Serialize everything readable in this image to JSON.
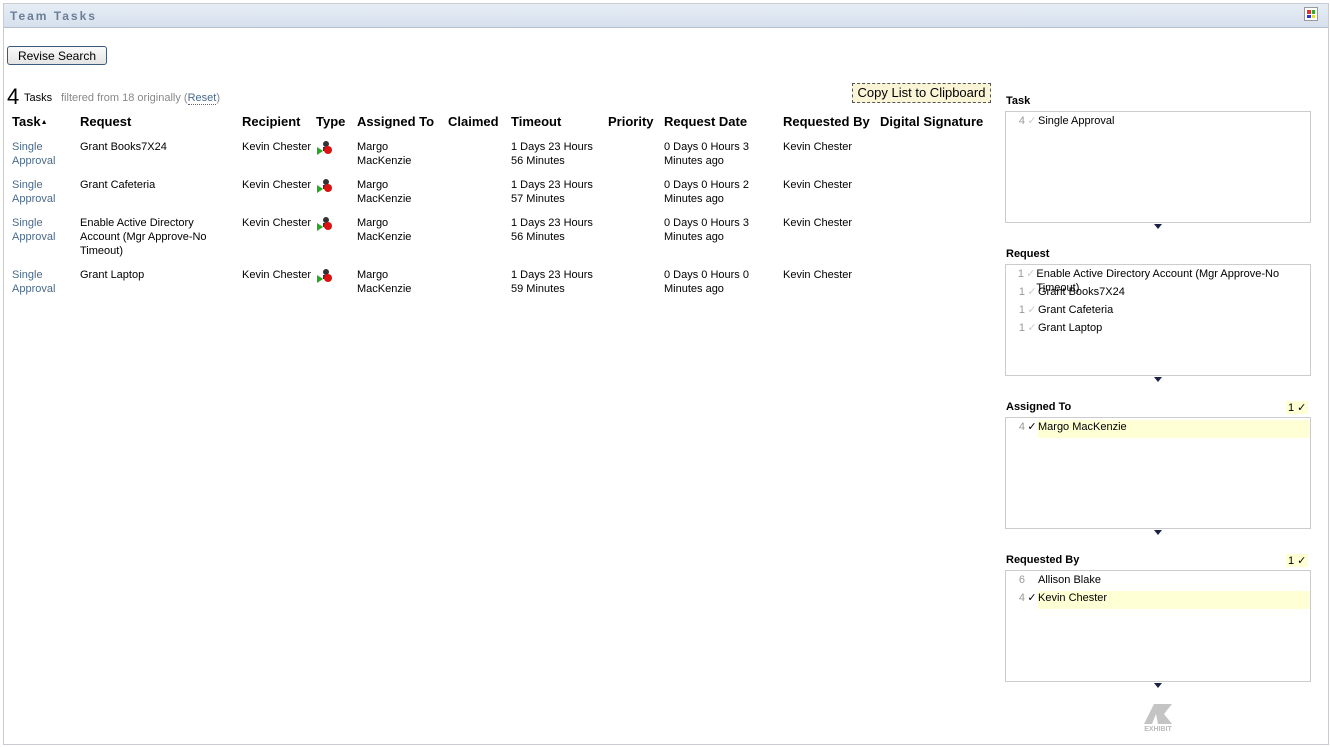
{
  "header": {
    "title": "Team Tasks",
    "icon": "grid-icon"
  },
  "revise_label": "Revise Search",
  "summary": {
    "count": "4",
    "label": "Tasks",
    "filtered_prefix": "filtered from 18 originally (",
    "reset": "Reset",
    "filtered_suffix": ")"
  },
  "copy_label": "Copy List to Clipboard",
  "columns": [
    "Task",
    "Request",
    "Recipient",
    "Type",
    "Assigned To",
    "Claimed",
    "Timeout",
    "Priority",
    "Request Date",
    "Requested By",
    "Digital Signature"
  ],
  "rows": [
    {
      "task": "Single Approval",
      "request": "Grant Books7X24",
      "recipient": "Kevin Chester",
      "assigned": "Margo MacKenzie",
      "claimed": "",
      "timeout": "1 Days 23 Hours 56 Minutes",
      "priority": "",
      "date": "0 Days 0 Hours 3 Minutes ago",
      "by": "Kevin Chester",
      "sig": ""
    },
    {
      "task": "Single Approval",
      "request": "Grant Cafeteria",
      "recipient": "Kevin Chester",
      "assigned": "Margo MacKenzie",
      "claimed": "",
      "timeout": "1 Days 23 Hours 57 Minutes",
      "priority": "",
      "date": "0 Days 0 Hours 2 Minutes ago",
      "by": "Kevin Chester",
      "sig": ""
    },
    {
      "task": "Single Approval",
      "request": "Enable Active Directory Account (Mgr Approve-No Timeout)",
      "recipient": "Kevin Chester",
      "assigned": "Margo MacKenzie",
      "claimed": "",
      "timeout": "1 Days 23 Hours 56 Minutes",
      "priority": "",
      "date": "0 Days 0 Hours 3 Minutes ago",
      "by": "Kevin Chester",
      "sig": ""
    },
    {
      "task": "Single Approval",
      "request": "Grant Laptop",
      "recipient": "Kevin Chester",
      "assigned": "Margo MacKenzie",
      "claimed": "",
      "timeout": "1 Days 23 Hours 59 Minutes",
      "priority": "",
      "date": "0 Days 0 Hours 0 Minutes ago",
      "by": "Kevin Chester",
      "sig": ""
    }
  ],
  "facets": [
    {
      "title": "Task",
      "selected": "",
      "items": [
        {
          "n": "4",
          "label": "Single Approval",
          "sel": false
        }
      ]
    },
    {
      "title": "Request",
      "selected": "",
      "items": [
        {
          "n": "1",
          "label": "Enable Active Directory Account (Mgr Approve-No Timeout)",
          "sel": false
        },
        {
          "n": "1",
          "label": "Grant Books7X24",
          "sel": false
        },
        {
          "n": "1",
          "label": "Grant Cafeteria",
          "sel": false
        },
        {
          "n": "1",
          "label": "Grant Laptop",
          "sel": false
        }
      ]
    },
    {
      "title": "Assigned To",
      "selected": "1 ✓",
      "items": [
        {
          "n": "4",
          "label": "Margo MacKenzie",
          "sel": true
        }
      ]
    },
    {
      "title": "Requested By",
      "selected": "1 ✓",
      "items": [
        {
          "n": "6",
          "label": "Allison Blake",
          "sel": false,
          "nocheck": true
        },
        {
          "n": "4",
          "label": "Kevin Chester",
          "sel": true
        }
      ]
    }
  ],
  "logo_text": "EXHIBIT"
}
